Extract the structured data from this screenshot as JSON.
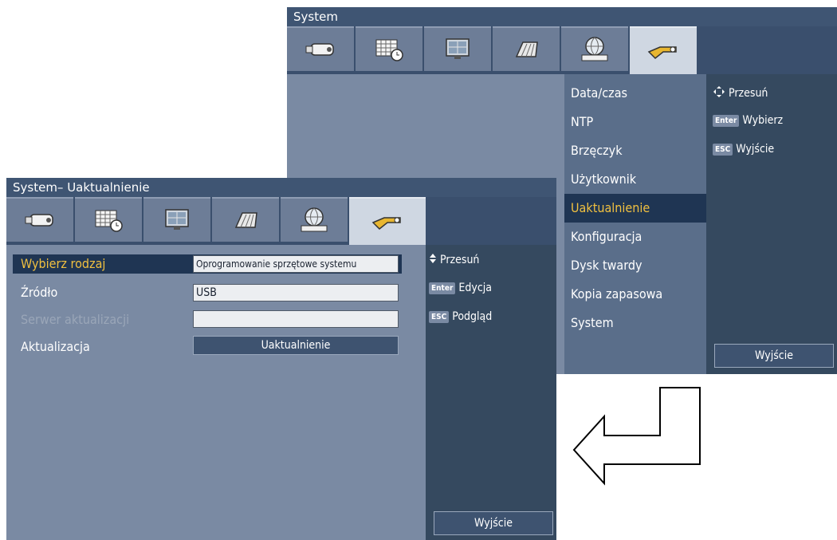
{
  "top_window": {
    "title": "System",
    "tabs": [
      "camera-icon",
      "schedule-icon",
      "monitor-icon",
      "storage-icon",
      "network-icon",
      "tools-icon"
    ],
    "active_tab": 5,
    "menu": {
      "items": [
        "Data/czas",
        "NTP",
        "Brzęczyk",
        "Użytkownik",
        "Uaktualnienie",
        "Konfiguracja",
        "Dysk twardy",
        "Kopia zapasowa",
        "System"
      ],
      "selected_index": 4
    },
    "hints": [
      {
        "icon": "move-arrows-icon",
        "key": "",
        "text": "Przesuń"
      },
      {
        "icon": "",
        "key": "Enter",
        "text": "Wybierz"
      },
      {
        "icon": "",
        "key": "ESC",
        "text": "Wyjście"
      }
    ],
    "exit_button": "Wyjście"
  },
  "bottom_window": {
    "title": "System– Uaktualnienie",
    "tabs": [
      "camera-icon",
      "schedule-icon",
      "monitor-icon",
      "storage-icon",
      "network-icon",
      "tools-icon"
    ],
    "active_tab": 5,
    "form": {
      "select_type_label": "Wybierz rodzaj",
      "select_type_value": "Oprogramowanie sprzętowe systemu",
      "source_label": "Źródło",
      "source_value": "USB",
      "server_label": "Serwer aktualizacji",
      "server_value": "",
      "update_label": "Aktualizacja",
      "update_button": "Uaktualnienie"
    },
    "hints": [
      {
        "icon": "updown-arrow-icon",
        "key": "",
        "text": "Przesuń"
      },
      {
        "icon": "",
        "key": "Enter",
        "text": "Edycja"
      },
      {
        "icon": "",
        "key": "ESC",
        "text": "Podgląd"
      }
    ],
    "exit_button": "Wyjście"
  },
  "colors": {
    "window_bg": "#7a8aa3",
    "title_bar": "#3f5573",
    "side_panel": "#35495f",
    "selected_bg": "#1f3553",
    "selected_text": "#f0c040"
  }
}
